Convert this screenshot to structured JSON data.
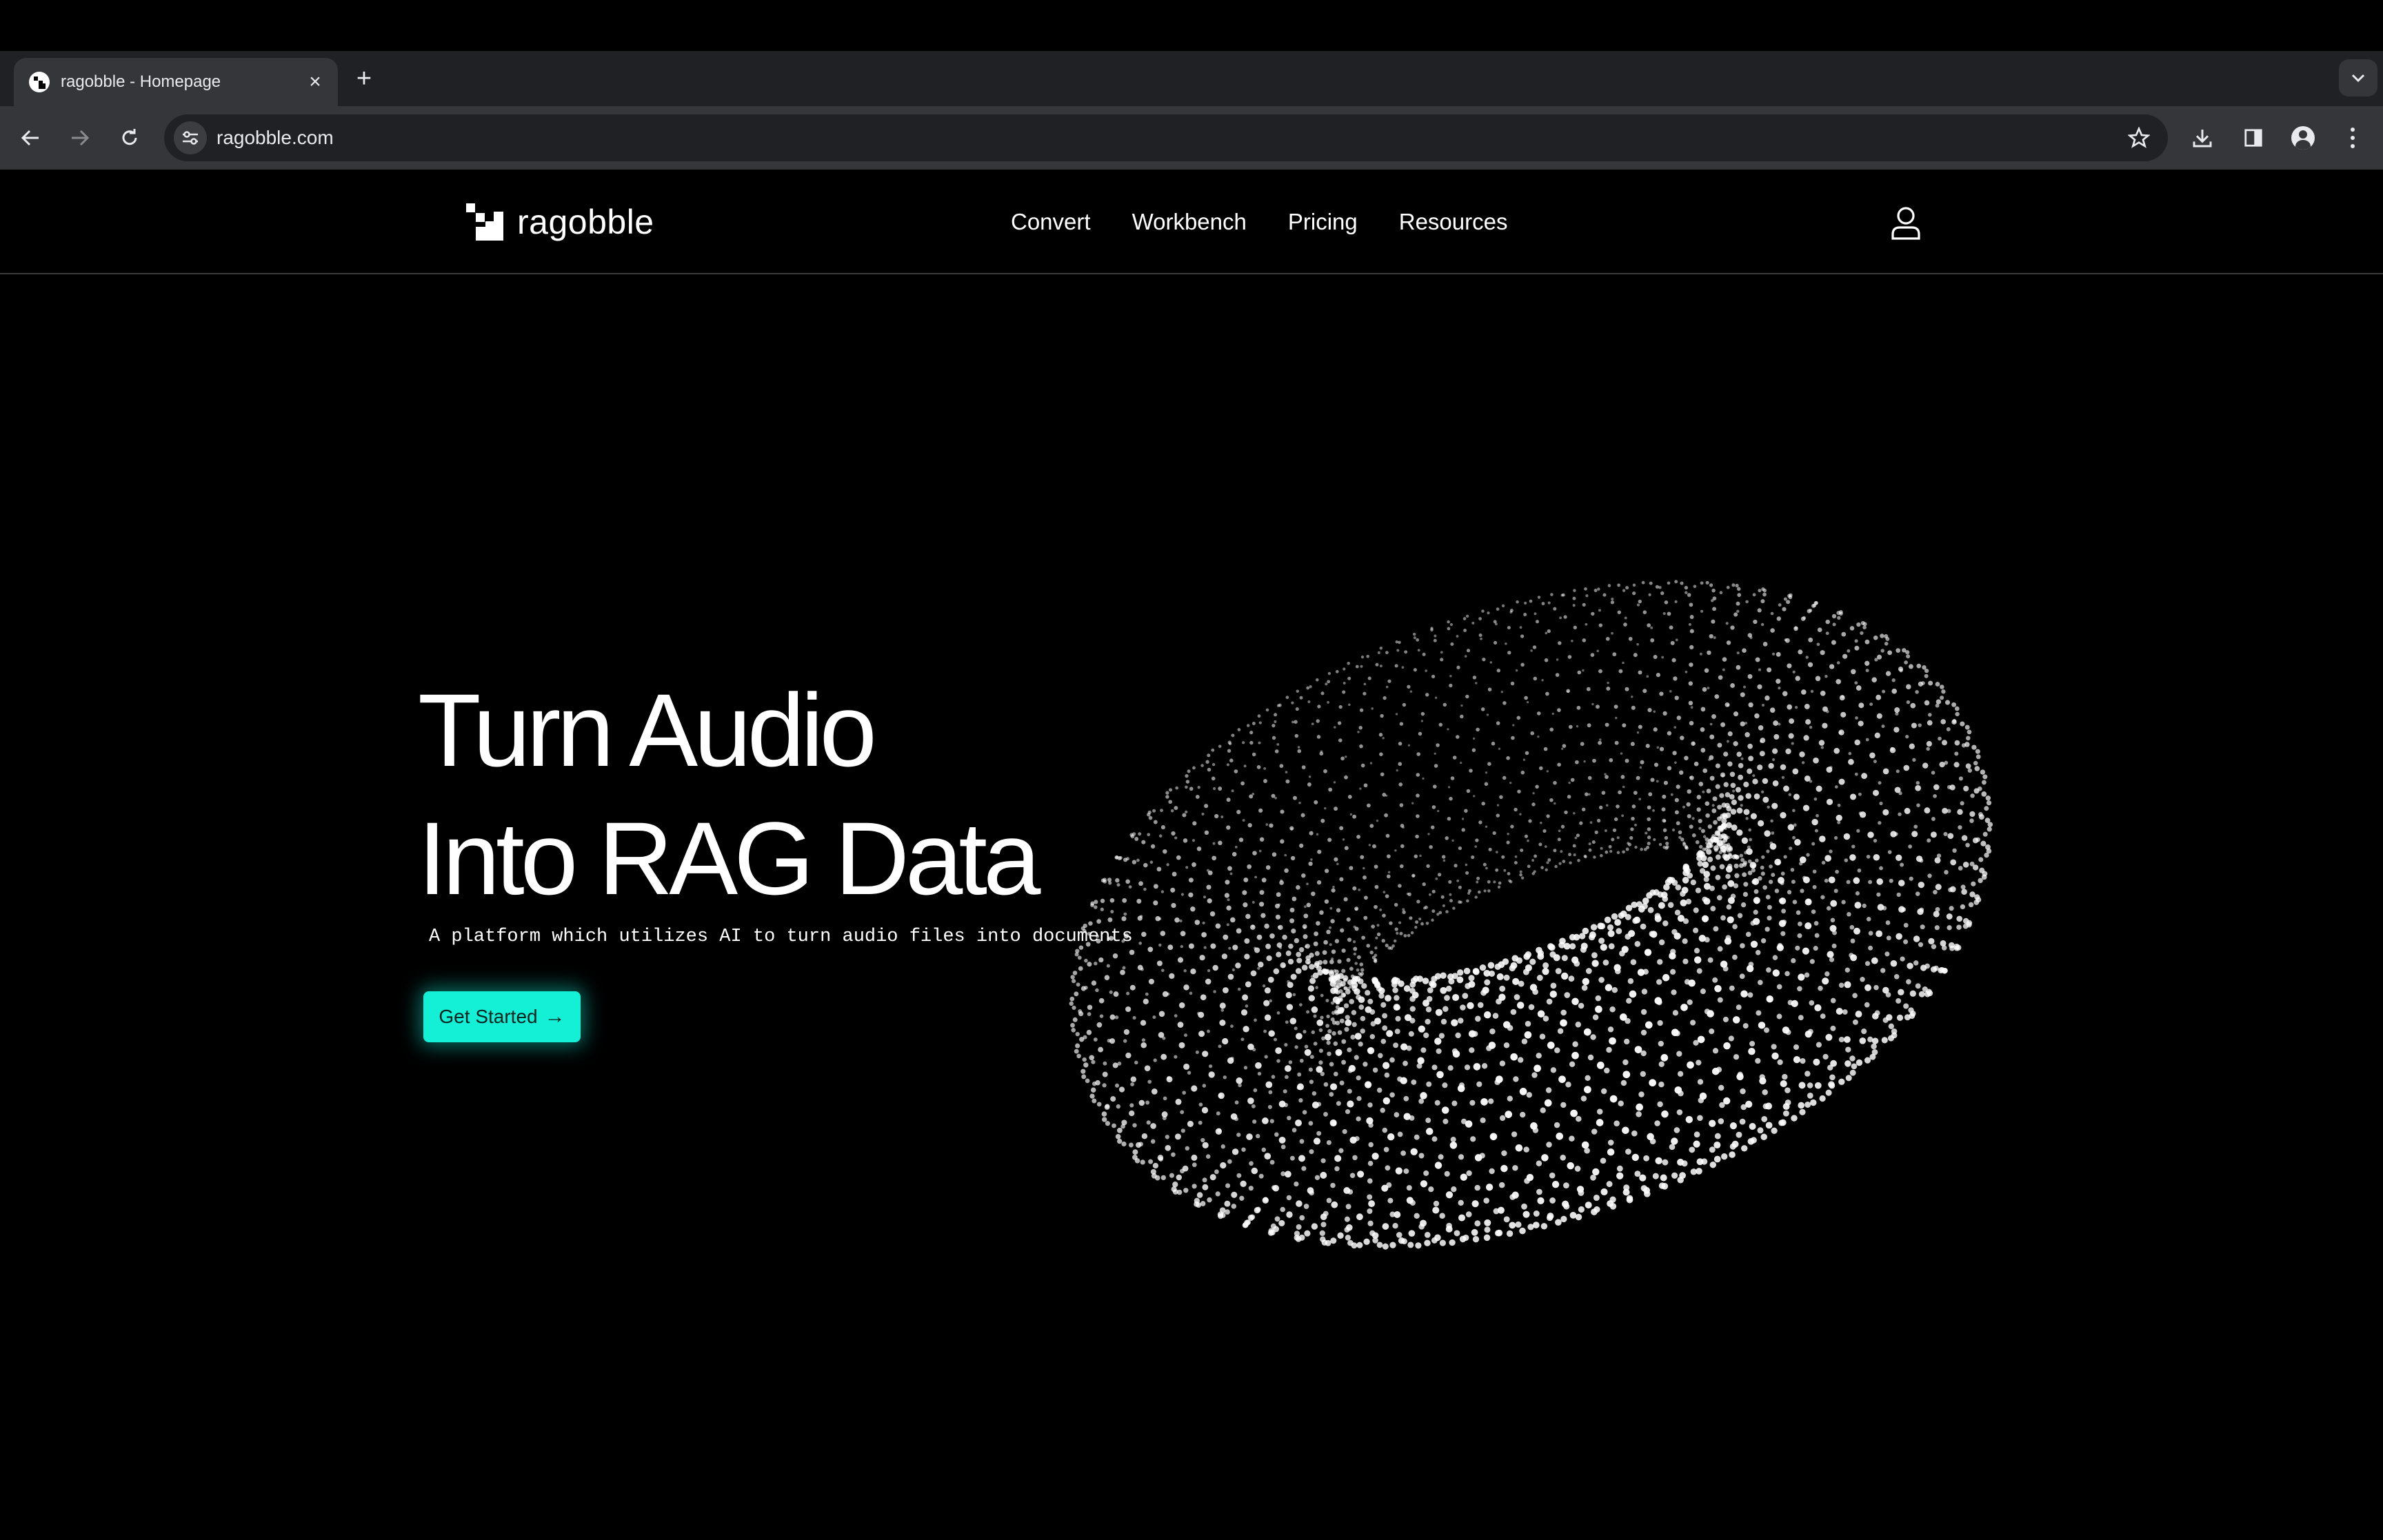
{
  "browser": {
    "tab_title": "ragobble - Homepage",
    "tab_close_icon": "close-icon",
    "new_tab_icon": "plus-icon",
    "url": "ragobble.com"
  },
  "site": {
    "logo_text": "ragobble",
    "nav": [
      "Convert",
      "Workbench",
      "Pricing",
      "Resources"
    ],
    "account_icon": "user-icon"
  },
  "hero": {
    "title_line1": "Turn Audio",
    "title_line2": "Into RAG Data",
    "subtitle": "A platform which utilizes AI to turn audio files into documents",
    "cta_label": "Get Started",
    "cta_icon": "arrow-right-icon"
  },
  "colors": {
    "background": "#000000",
    "accent": "#14f0d6",
    "chrome_dark": "#202124",
    "chrome_mid": "#35363a"
  }
}
